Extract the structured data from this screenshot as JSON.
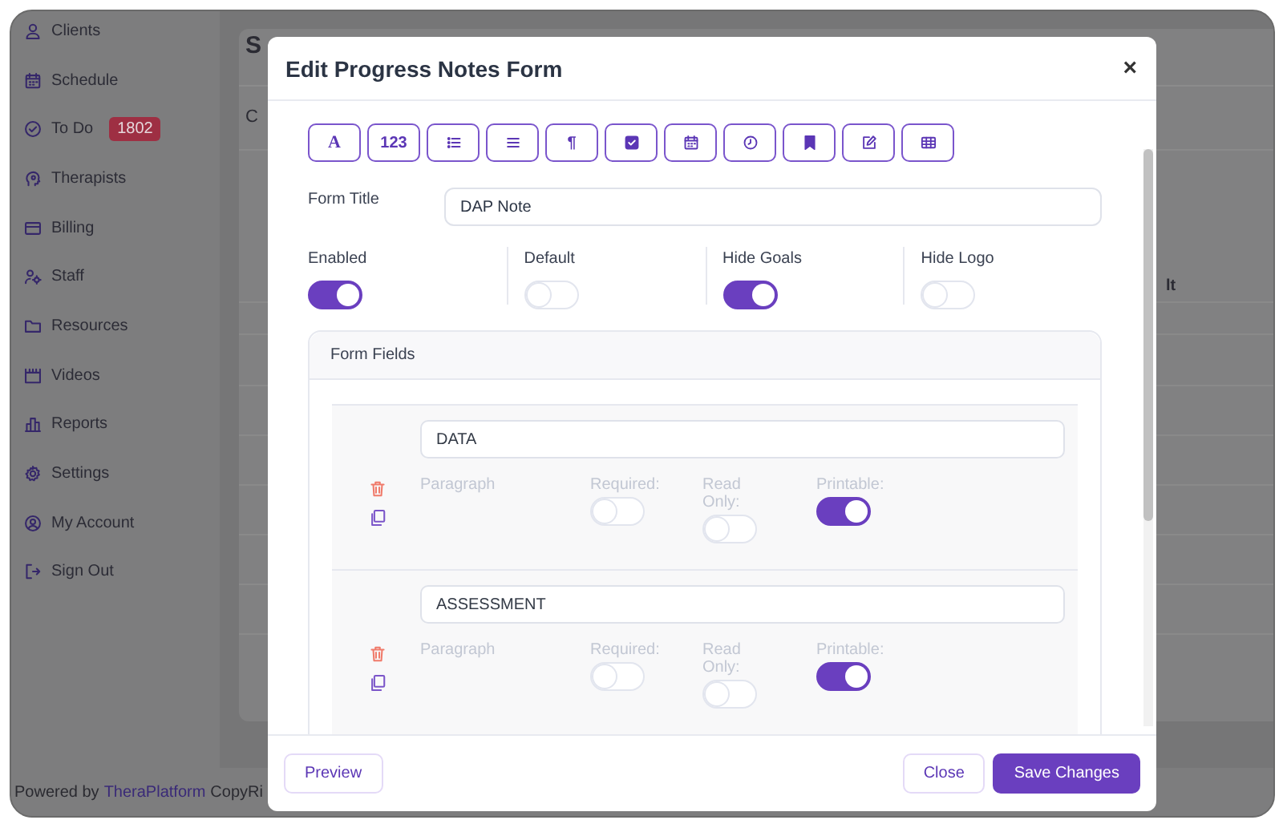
{
  "sidebar": {
    "items": [
      {
        "label": "Clients"
      },
      {
        "label": "Schedule"
      },
      {
        "label": "To Do",
        "badge": "1802"
      },
      {
        "label": "Therapists"
      },
      {
        "label": "Billing"
      },
      {
        "label": "Staff"
      },
      {
        "label": "Resources"
      },
      {
        "label": "Videos"
      },
      {
        "label": "Reports"
      },
      {
        "label": "Settings"
      },
      {
        "label": "My Account"
      },
      {
        "label": "Sign Out"
      }
    ]
  },
  "background_page": {
    "heading": "S",
    "label": "C",
    "column_header": "lt"
  },
  "footer": {
    "prefix": "Powered by",
    "link": "TheraPlatform",
    "suffix": "CopyRi"
  },
  "modal": {
    "title": "Edit Progress Notes Form",
    "close": "×",
    "toolbar": [
      {
        "kind": "text",
        "label": "A"
      },
      {
        "kind": "text",
        "label": "123"
      },
      {
        "kind": "icon"
      },
      {
        "kind": "icon"
      },
      {
        "kind": "text",
        "label": "¶"
      },
      {
        "kind": "icon"
      },
      {
        "kind": "icon"
      },
      {
        "kind": "icon"
      },
      {
        "kind": "icon"
      },
      {
        "kind": "icon"
      },
      {
        "kind": "icon"
      }
    ],
    "form_title": {
      "label": "Form Title",
      "value": "DAP Note"
    },
    "settings": [
      {
        "label": "Enabled",
        "on": true
      },
      {
        "label": "Default",
        "on": false
      },
      {
        "label": "Hide Goals",
        "on": true
      },
      {
        "label": "Hide Logo",
        "on": false
      }
    ],
    "form_fields": {
      "title": "Form Fields",
      "fields": [
        {
          "name": "DATA",
          "type": "Paragraph",
          "options": [
            {
              "label": "Required:",
              "on": false
            },
            {
              "label": "Read Only:",
              "on": false
            },
            {
              "label": "Printable:",
              "on": true
            }
          ]
        },
        {
          "name": "ASSESSMENT",
          "type": "Paragraph",
          "options": [
            {
              "label": "Required:",
              "on": false
            },
            {
              "label": "Read Only:",
              "on": false
            },
            {
              "label": "Printable:",
              "on": true
            }
          ]
        }
      ]
    },
    "buttons": {
      "preview": "Preview",
      "close": "Close",
      "save": "Save Changes"
    }
  }
}
